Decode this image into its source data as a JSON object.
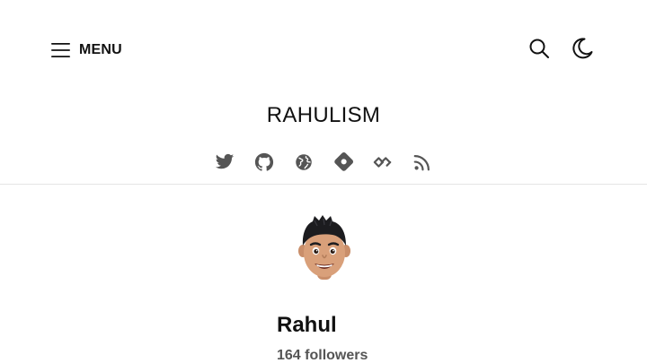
{
  "header": {
    "menu_label": "MENU",
    "icons": {
      "menu": "hamburger-icon",
      "search": "search-icon",
      "theme": "moon-icon"
    }
  },
  "site": {
    "title": "RAHULISM"
  },
  "social_links": [
    {
      "name": "twitter-icon"
    },
    {
      "name": "github-icon"
    },
    {
      "name": "globe-icon"
    },
    {
      "name": "hashnode-icon"
    },
    {
      "name": "devto-icon"
    },
    {
      "name": "rss-icon"
    }
  ],
  "profile": {
    "avatar": "memoji-avatar",
    "name": "Rahul",
    "followers_count": "164",
    "followers_label": "followers"
  },
  "colors": {
    "text": "#111111",
    "icon": "#555555",
    "divider": "#e5e5e5",
    "background": "#ffffff"
  }
}
